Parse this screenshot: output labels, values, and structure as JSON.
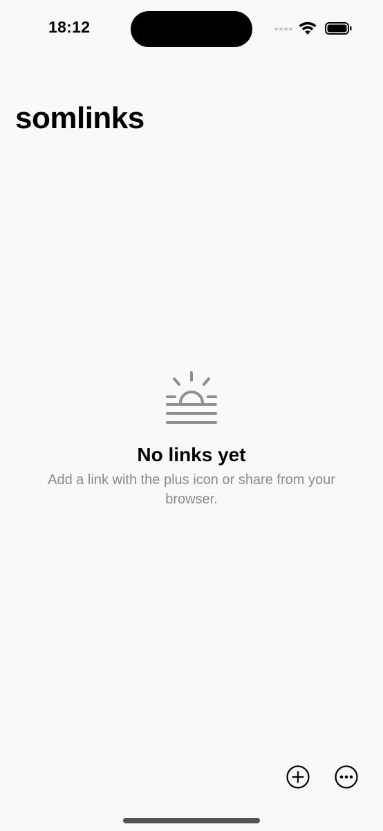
{
  "status_bar": {
    "time": "18:12",
    "icons": [
      "cellular-signal-icon",
      "wifi-icon",
      "battery-icon"
    ]
  },
  "header": {
    "title": "somlinks"
  },
  "empty_state": {
    "icon": "sunrise-icon",
    "title": "No links yet",
    "message": "Add a link with the plus icon or share from your browser."
  },
  "toolbar": {
    "add_icon": "plus-circle-icon",
    "more_icon": "ellipsis-circle-icon"
  },
  "colors": {
    "background": "#f9f9f9",
    "secondary_text": "#8a8a8e",
    "icon_gray": "#8e8e93"
  }
}
